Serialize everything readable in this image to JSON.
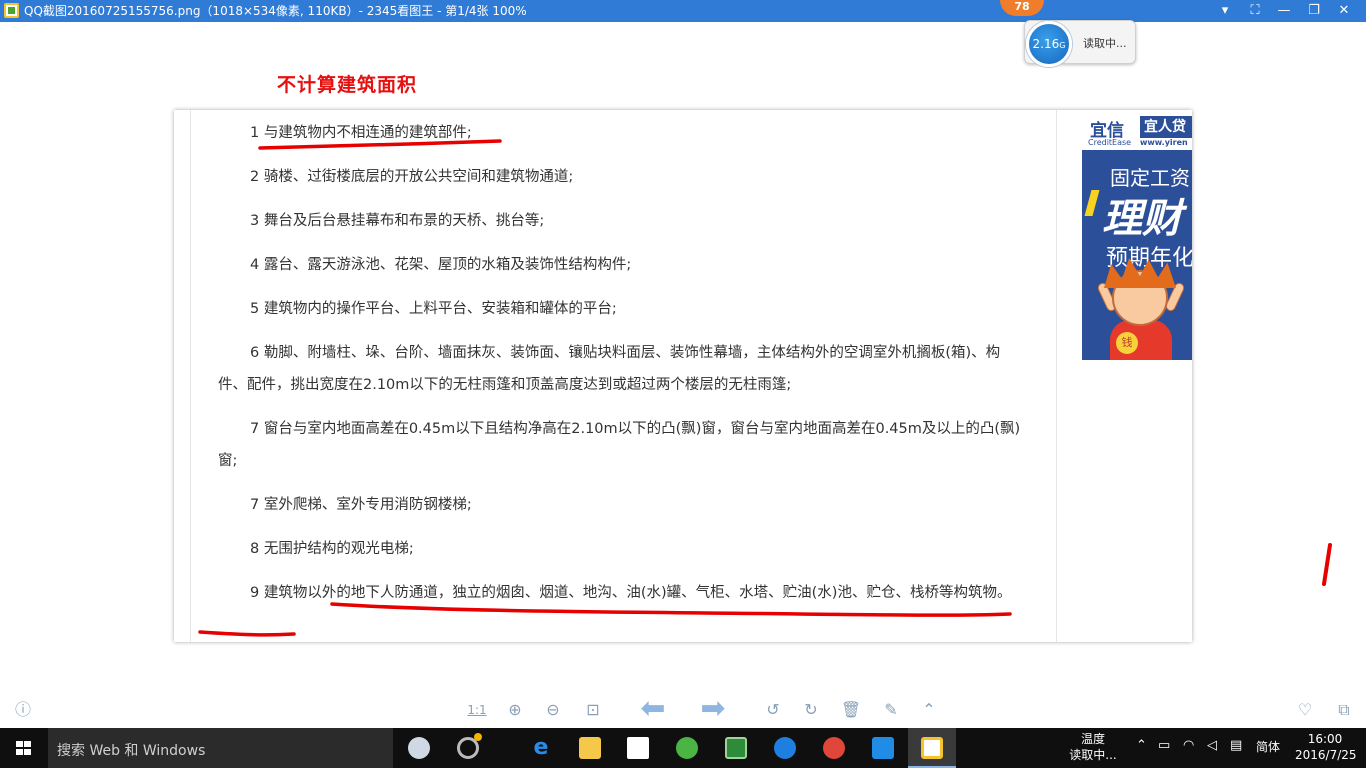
{
  "window": {
    "title": "QQ截图20160725155756.png（1018×534像素, 110KB）- 2345看图王 - 第1/4张 100%",
    "buttons": {
      "dropdown": "▾",
      "fullscreen": "⛶",
      "minimize": "—",
      "restore": "❐",
      "close": "✕"
    }
  },
  "speed_widget": {
    "badge": "78",
    "value": "2.16",
    "unit": "G",
    "status": "读取中..."
  },
  "content": {
    "heading": "不计算建筑面积",
    "items": [
      "1 与建筑物内不相连通的建筑部件;",
      "2 骑楼、过街楼底层的开放公共空间和建筑物通道;",
      "3 舞台及后台悬挂幕布和布景的天桥、挑台等;",
      "4 露台、露天游泳池、花架、屋顶的水箱及装饰性结构构件;",
      "5 建筑物内的操作平台、上料平台、安装箱和罐体的平台;",
      "6 勒脚、附墙柱、垛、台阶、墙面抹灰、装饰面、镶贴块料面层、装饰性幕墙，主体结构外的空调室外机搁板(箱)、构件、配件，挑出宽度在2.10m以下的无柱雨篷和顶盖高度达到或超过两个楼层的无柱雨篷;",
      "7 窗台与室内地面高差在0.45m以下且结构净高在2.10m以下的凸(飘)窗，窗台与室内地面高差在0.45m及以上的凸(飘)窗;",
      "7 室外爬梯、室外专用消防钢楼梯;",
      "8 无围护结构的观光电梯;",
      "9 建筑物以外的地下人防通道，独立的烟囱、烟道、地沟、油(水)罐、气柜、水塔、贮油(水)池、贮仓、栈桥等构筑物。"
    ]
  },
  "ad": {
    "logo_cn": "宜信",
    "logo_en": "CreditEase",
    "logo2": "宜人贷",
    "logo2_url": "www.yiren",
    "line1": "固定工资",
    "line2": "理财",
    "line3": "预期年化",
    "coin": "钱"
  },
  "toolbar": {
    "info": "ⓘ",
    "actual_size": "1:1",
    "zoom_in": "⊕",
    "zoom_out": "⊖",
    "fit": "⊡",
    "prev": "⬅",
    "next": "➡",
    "rotate_left": "↺",
    "rotate_right": "↻",
    "delete": "🗑",
    "edit": "✎",
    "up": "⌃",
    "favorite": "♡",
    "folder": "⧉"
  },
  "taskbar": {
    "search_placeholder": "搜索 Web 和 Windows",
    "tray_temp_label": "温度",
    "tray_temp_status": "读取中...",
    "ime": "简体",
    "time": "16:00",
    "date": "2016/7/25"
  },
  "colors": {
    "titlebar": "#2f7bd6",
    "heading": "#e61010",
    "annotation": "#e60000",
    "ad_bg": "#2c4f9a"
  }
}
